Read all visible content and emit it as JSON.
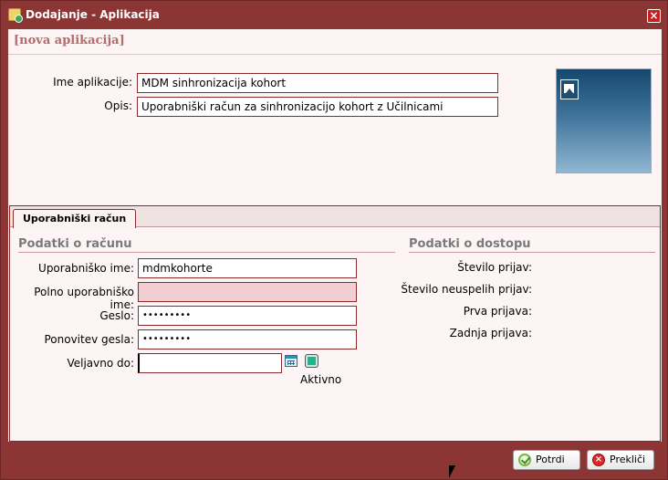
{
  "window": {
    "title": "Dodajanje - Aplikacija",
    "close_symbol": "×",
    "title_icon": "app-add-icon"
  },
  "header": {
    "record_title": "[nova aplikacija]"
  },
  "app_form": {
    "name_label": "Ime aplikacije:",
    "name_value": "MDM sinhronizacija kohort",
    "description_label": "Opis:",
    "description_value": "Uporabniški račun za sinhronizacijo kohort z Učilnicami",
    "picture_icon": "image-upload-icon"
  },
  "tabs": [
    {
      "label": "Uporabniški račun",
      "active": true
    }
  ],
  "account": {
    "section_title": "Podatki o računu",
    "username_label": "Uporabniško ime:",
    "username_value": "mdmkohorte",
    "full_username_label": "Polno uporabniško ime:",
    "full_username_value": "",
    "password_label": "Geslo:",
    "password_value": "•••••••••",
    "password_repeat_label": "Ponovitev gesla:",
    "password_repeat_value": "•••••••••",
    "valid_until_label": "Veljavno do:",
    "valid_until_value": "",
    "calendar_icon": "calendar-icon",
    "active_label": "Aktivno",
    "active_checked": true
  },
  "access": {
    "section_title": "Podatki o dostopu",
    "login_count_label": "Število prijav:",
    "failed_login_count_label": "Število neuspelih prijav:",
    "first_login_label": "Prva prijava:",
    "last_login_label": "Zadnja prijava:"
  },
  "footer": {
    "confirm_label": "Potrdi",
    "cancel_label": "Prekliči"
  },
  "colors": {
    "frame": "#8b3535",
    "content_bg": "#fdf5f5",
    "required_field": "#f1cdd4",
    "accent_title": "#b66a6a"
  }
}
